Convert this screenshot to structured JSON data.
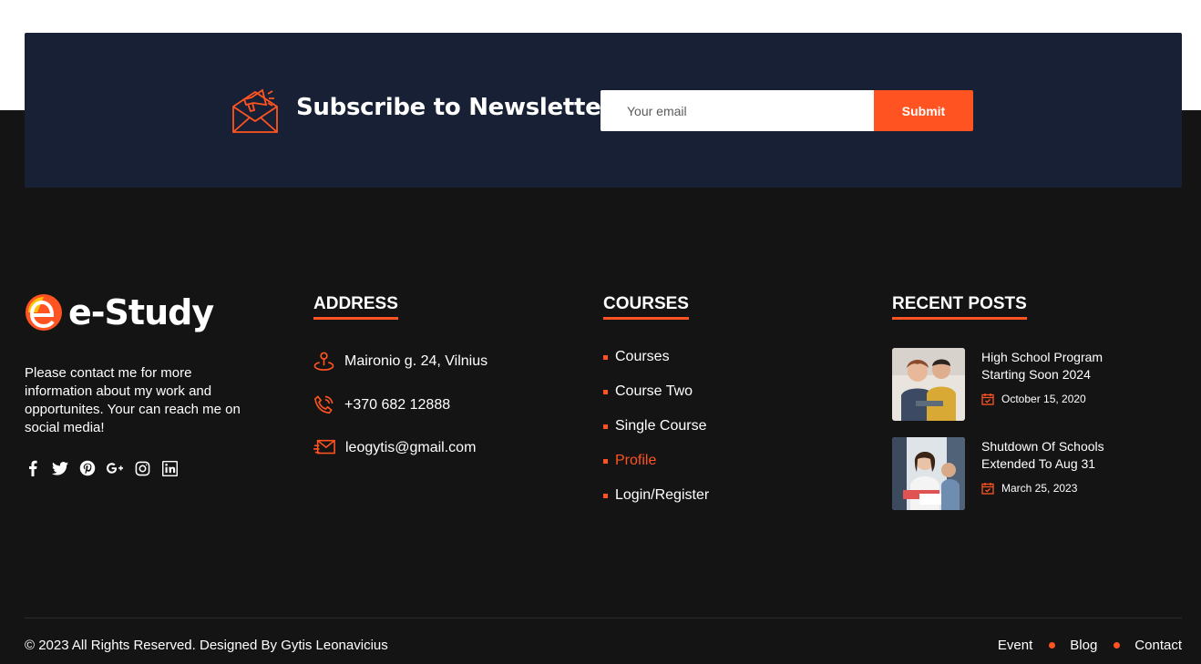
{
  "newsletter": {
    "title": "Subscribe to Newsletter",
    "email_placeholder": "Your email",
    "submit_label": "Submit",
    "icon": "megaphone-envelope-icon"
  },
  "brand": {
    "logo_text": "e-Study",
    "about": "Please contact me for more information about my work and opportunites. Your can reach me on social media!",
    "social_icons": [
      "facebook-icon",
      "twitter-icon",
      "pinterest-icon",
      "google-plus-icon",
      "instagram-icon",
      "linkedin-icon"
    ]
  },
  "address": {
    "title": "ADDRESS",
    "location": "Maironio g. 24, Vilnius",
    "phone": "+370 682 12888",
    "email": "leogytis@gmail.com"
  },
  "courses": {
    "title": "COURSES",
    "items": [
      {
        "label": "Courses",
        "active": false
      },
      {
        "label": "Course Two",
        "active": false
      },
      {
        "label": "Single Course",
        "active": false
      },
      {
        "label": "Profile",
        "active": true
      },
      {
        "label": "Login/Register",
        "active": false
      }
    ]
  },
  "recent_posts": {
    "title": "RECENT POSTS",
    "posts": [
      {
        "title": "High School Program Starting Soon 2024",
        "date": "October 15, 2020"
      },
      {
        "title": "Shutdown Of Schools Extended To Aug 31",
        "date": "March 25, 2023"
      }
    ]
  },
  "footer": {
    "copyright": "© 2023 All Rights Reserved. Designed By Gytis Leonavicius",
    "links": [
      "Event",
      "Blog",
      "Contact"
    ]
  },
  "colors": {
    "accent": "#ff5421",
    "newsletter_bg": "#172034",
    "footer_bg": "#141414"
  }
}
